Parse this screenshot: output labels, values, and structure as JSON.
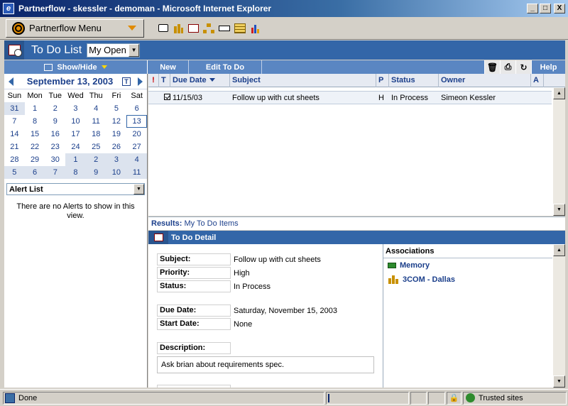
{
  "window": {
    "title": "Partnerflow - skessler - demoman - Microsoft Internet Explorer",
    "buttons": [
      "_",
      "□",
      "X"
    ]
  },
  "menubar": {
    "menu_label": "Partnerflow Menu",
    "icons": [
      "book-icon",
      "company-icon",
      "todo-icon",
      "org-chart-icon",
      "tape-icon",
      "table-icon",
      "chart-icon"
    ]
  },
  "module": {
    "title": "To Do List",
    "view_select": "My Open"
  },
  "actions": {
    "show_hide": "Show/Hide",
    "new": "New",
    "edit": "Edit To Do",
    "help": "Help"
  },
  "calendar": {
    "month": "September 13, 2003",
    "today_btn": "T",
    "weekdays": [
      "Sun",
      "Mon",
      "Tue",
      "Wed",
      "Thu",
      "Fri",
      "Sat"
    ],
    "weeks": [
      [
        "31",
        "1",
        "2",
        "3",
        "4",
        "5",
        "6"
      ],
      [
        "7",
        "8",
        "9",
        "10",
        "11",
        "12",
        "13"
      ],
      [
        "14",
        "15",
        "16",
        "17",
        "18",
        "19",
        "20"
      ],
      [
        "21",
        "22",
        "23",
        "24",
        "25",
        "26",
        "27"
      ],
      [
        "28",
        "29",
        "30",
        "1",
        "2",
        "3",
        "4"
      ],
      [
        "5",
        "6",
        "7",
        "8",
        "9",
        "10",
        "11"
      ]
    ]
  },
  "alerts": {
    "select": "Alert List",
    "empty_text": "There are no Alerts to show in this view."
  },
  "list": {
    "columns": {
      "flag": "!",
      "type": "T",
      "due": "Due Date",
      "subject": "Subject",
      "priority": "P",
      "status": "Status",
      "owner": "Owner",
      "a": "A"
    },
    "rows": [
      {
        "due": "11/15/03",
        "subject": "Follow up with cut sheets",
        "priority": "H",
        "status": "In Process",
        "owner": "Simeon Kessler"
      }
    ]
  },
  "results": {
    "label": "Results:",
    "value": "My To Do Items"
  },
  "detail": {
    "title": "To Do Detail",
    "subject_label": "Subject:",
    "subject": "Follow up with cut sheets",
    "priority_label": "Priority:",
    "priority": "High",
    "status_label": "Status:",
    "status": "In Process",
    "due_label": "Due Date:",
    "due": "Saturday, November 15, 2003",
    "start_label": "Start Date:",
    "start": "None",
    "desc_label": "Description:",
    "description": "Ask brian about requirements spec."
  },
  "associations": {
    "title": "Associations",
    "items": [
      "Memory",
      "3COM - Dallas"
    ]
  },
  "statusbar": {
    "text": "Done",
    "zone": "Trusted sites"
  }
}
